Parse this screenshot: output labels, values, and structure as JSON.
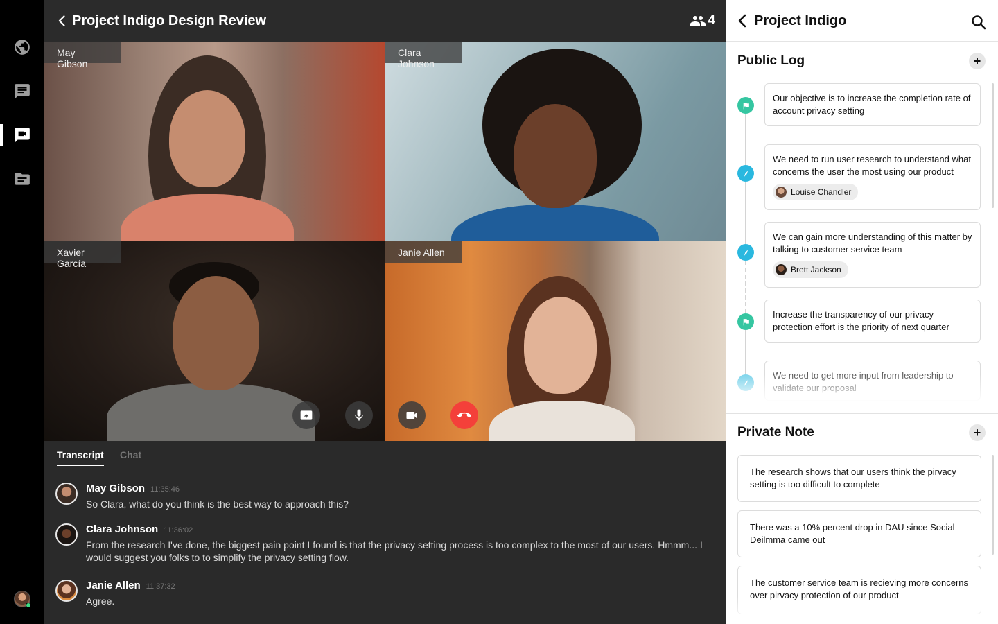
{
  "rail": {
    "items": [
      {
        "icon": "globe-icon",
        "active": false
      },
      {
        "icon": "message-icon",
        "active": false
      },
      {
        "icon": "video-chat-icon",
        "active": true
      },
      {
        "icon": "folder-icon",
        "active": false
      }
    ]
  },
  "call": {
    "title": "Project Indigo Design Review",
    "participant_count": "4",
    "participants": [
      {
        "name": "May Gibson"
      },
      {
        "name": "Clara Johnson"
      },
      {
        "name": "Xavier García"
      },
      {
        "name": "Janie Allen"
      }
    ],
    "controls": [
      "share-screen-icon",
      "microphone-icon",
      "camera-icon",
      "end-call-icon"
    ]
  },
  "transcript": {
    "tabs": [
      "Transcript",
      "Chat"
    ],
    "messages": [
      {
        "name": "May Gibson",
        "time": "11:35:46",
        "text": "So Clara, what do you think is the best way to approach this?"
      },
      {
        "name": "Clara Johnson",
        "time": "11:36:02",
        "text": "From the research I've done, the biggest pain point I found is that the privacy setting process is too complex to the most of our users. Hmmm... I would suggest you folks to to simplify the privacy setting flow."
      },
      {
        "name": "Janie Allen",
        "time": "11:37:32",
        "text": "Agree."
      }
    ]
  },
  "panel": {
    "title": "Project Indigo",
    "public_log": {
      "title": "Public Log",
      "entries": [
        {
          "type": "flag",
          "text": "Our objective is to increase the completion rate of account privacy setting"
        },
        {
          "type": "pen",
          "text": "We need to run user research to understand what concerns the user the most using our product",
          "assignee": "Louise Chandler"
        },
        {
          "type": "pen",
          "text": "We can gain more understanding of this matter by talking to customer service team",
          "assignee": "Brett Jackson"
        },
        {
          "type": "flag",
          "text": "Increase the transparency of our privacy protection effort is the priority of next quarter"
        },
        {
          "type": "pen",
          "text": "We need to get more input from leadership to validate our proposal"
        }
      ]
    },
    "private_note": {
      "title": "Private Note",
      "notes": [
        "The research shows that our users think the pirvacy setting is too difficult to complete",
        "There was a 10% percent drop in DAU since Social Deilmma came out",
        "The customer service team is recieving more concerns over pirvacy protection of our product"
      ]
    }
  },
  "colors": {
    "end_call": "#f4403a",
    "flag_dot": "#35c6a1",
    "pen_dot": "#2ab8df",
    "online": "#3ddc84"
  }
}
